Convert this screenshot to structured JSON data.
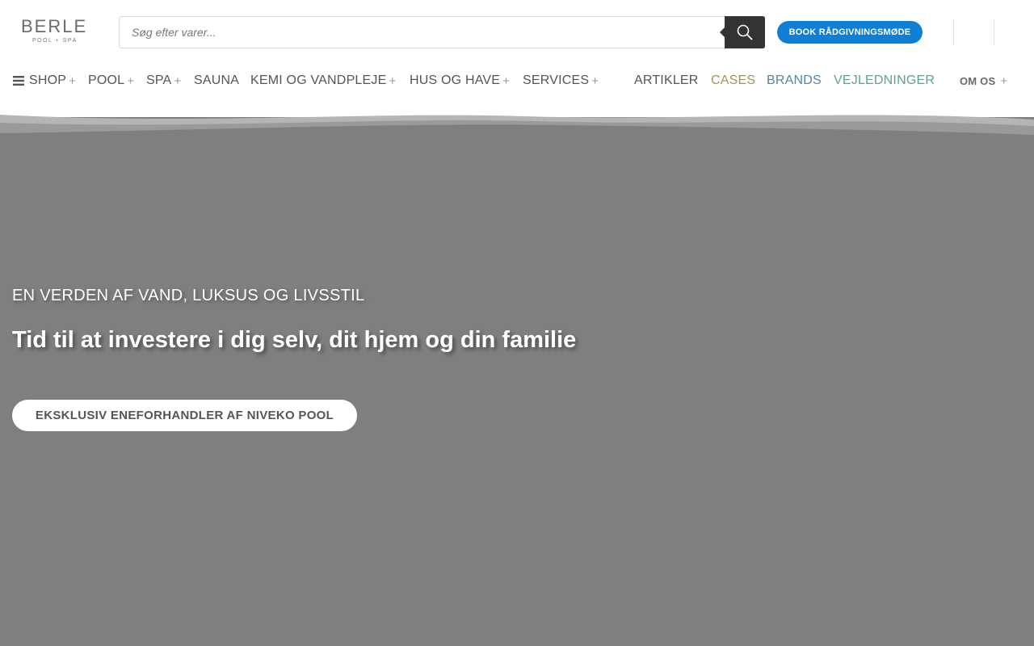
{
  "brand": {
    "logo_main": "BERLE",
    "logo_sub": "POOL + SPA"
  },
  "search": {
    "placeholder": "Søg efter varer...",
    "value": "",
    "button_icon": "search-icon"
  },
  "header": {
    "book_label": "BOOK RÅDGIVNINGSMØDE",
    "book_color": "#0f7fd6"
  },
  "nav": {
    "shop": {
      "label": "SHOP",
      "plus": "+"
    },
    "pool": {
      "label": "POOL",
      "plus": "+"
    },
    "spa": {
      "label": "SPA",
      "plus": "+"
    },
    "sauna": {
      "label": "SAUNA"
    },
    "kemi": {
      "label": "KEMI OG VANDPLEJE",
      "plus": "+"
    },
    "hus": {
      "label": "HUS OG HAVE",
      "plus": "+"
    },
    "services": {
      "label": "SERVICES",
      "plus": "+"
    },
    "artikler": {
      "label": "ARTIKLER"
    },
    "cases": {
      "label": "CASES",
      "color": "#a99055"
    },
    "brands": {
      "label": "BRANDS",
      "color": "#4f87a5"
    },
    "vejledninger": {
      "label": "VEJLEDNINGER",
      "color": "#5aa48f"
    },
    "om_os": {
      "label": "OM OS",
      "plus": "+"
    }
  },
  "hero": {
    "subtitle": "EN VERDEN AF VAND, LUKSUS OG LIVSSTIL",
    "title": "Tid til at investere i dig selv, dit hjem og din familie",
    "button_label": "EKSKLUSIV ENEFORHANDLER AF NIVEKO POOL",
    "background": "#7f7f7f"
  }
}
